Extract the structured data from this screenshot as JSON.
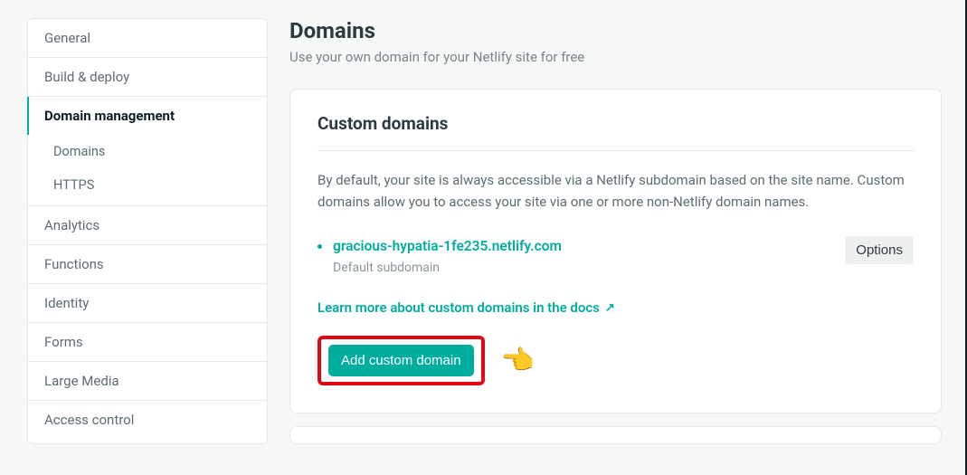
{
  "sidebar": {
    "items": [
      {
        "label": "General"
      },
      {
        "label": "Build & deploy"
      },
      {
        "label": "Domain management",
        "active": true,
        "sub": [
          {
            "label": "Domains"
          },
          {
            "label": "HTTPS"
          }
        ]
      },
      {
        "label": "Analytics"
      },
      {
        "label": "Functions"
      },
      {
        "label": "Identity"
      },
      {
        "label": "Forms"
      },
      {
        "label": "Large Media"
      },
      {
        "label": "Access control"
      }
    ]
  },
  "page": {
    "title": "Domains",
    "subtitle": "Use your own domain for your Netlify site for free"
  },
  "custom_domains": {
    "title": "Custom domains",
    "description": "By default, your site is always accessible via a Netlify subdomain based on the site name. Custom domains allow you to access your site via one or more non-Netlify domain names.",
    "domain_name": "gracious-hypatia-1fe235.netlify.com",
    "domain_meta": "Default subdomain",
    "options_label": "Options",
    "learn_more": "Learn more about custom domains in the docs",
    "add_button": "Add custom domain"
  }
}
